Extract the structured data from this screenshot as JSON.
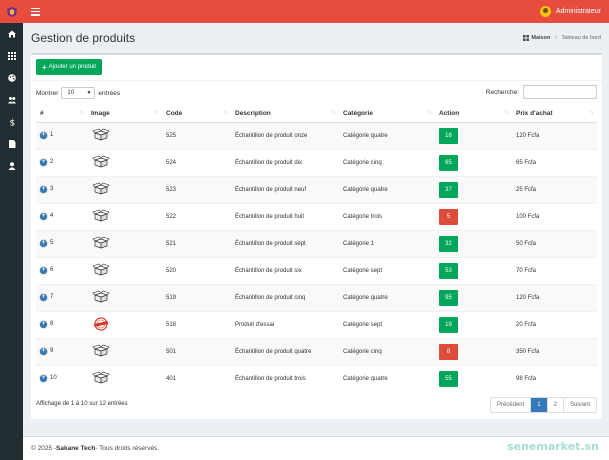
{
  "sidebar": {
    "logo_icon": "shield-logo-icon",
    "items": [
      {
        "icon": "home-icon"
      },
      {
        "icon": "grid-icon"
      },
      {
        "icon": "palette-icon"
      },
      {
        "icon": "users-icon"
      },
      {
        "icon": "dollar-icon"
      },
      {
        "icon": "file-icon"
      },
      {
        "icon": "user-icon"
      }
    ]
  },
  "header": {
    "menu_icon": "hamburger-icon",
    "user_name": "Administrateur"
  },
  "page": {
    "title": "Gestion de produits",
    "breadcrumb_home": "Maison",
    "breadcrumb_current": "Tableau de bord"
  },
  "toolbar": {
    "add_label": "Ajouter un produit"
  },
  "table_controls": {
    "show_label": "Montrer",
    "page_length": "10",
    "entries_label": "entrées",
    "search_label": "Recherche:",
    "search_value": ""
  },
  "table": {
    "columns": [
      "#",
      "Image",
      "Code",
      "Description",
      "Catégorie",
      "Action",
      "Prix d'achat"
    ],
    "rows": [
      {
        "num": "1",
        "image": "box",
        "code": "525",
        "description": "Échantillon de produit onze",
        "category": "Catégorie quatre",
        "action": "16",
        "status": "green",
        "price": "120 Fcfa"
      },
      {
        "num": "2",
        "image": "box",
        "code": "524",
        "description": "Échantillon de produit dix",
        "category": "Catégorie cinq",
        "action": "65",
        "status": "green",
        "price": "65 Fcfa"
      },
      {
        "num": "3",
        "image": "box",
        "code": "523",
        "description": "Échantillon de produit neuf",
        "category": "Catégorie quatre",
        "action": "37",
        "status": "green",
        "price": "25 Fcfa"
      },
      {
        "num": "4",
        "image": "box",
        "code": "522",
        "description": "Échantillon de produit huit",
        "category": "Catégorie trois",
        "action": "5",
        "status": "red",
        "price": "100 Fcfa"
      },
      {
        "num": "5",
        "image": "box",
        "code": "521",
        "description": "Échantillon de produit sept",
        "category": "Catégorie 1",
        "action": "32",
        "status": "green",
        "price": "50 Fcfa"
      },
      {
        "num": "6",
        "image": "box",
        "code": "520",
        "description": "Échantillon de produit six",
        "category": "Catégorie sept",
        "action": "53",
        "status": "green",
        "price": "70 Fcfa"
      },
      {
        "num": "7",
        "image": "box",
        "code": "519",
        "description": "Échantillon de produit cinq",
        "category": "Catégorie quatre",
        "action": "95",
        "status": "green",
        "price": "120 Fcfa"
      },
      {
        "num": "8",
        "image": "stamp",
        "code": "518",
        "description": "Produit d'essai",
        "category": "Catégorie sept",
        "action": "19",
        "status": "green",
        "price": "20 Fcfa"
      },
      {
        "num": "9",
        "image": "box",
        "code": "501",
        "description": "Échantillon de produit quatre",
        "category": "Catégorie cinq",
        "action": "8",
        "status": "red",
        "price": "350 Fcfa"
      },
      {
        "num": "10",
        "image": "box",
        "code": "401",
        "description": "Échantillon de produit trois",
        "category": "Catégorie quatre",
        "action": "55",
        "status": "green",
        "price": "98 Fcfa"
      }
    ]
  },
  "pagination": {
    "info": "Affichage de 1 à 10 sur 12 entrées",
    "prev": "Précédent",
    "pages": [
      "1",
      "2"
    ],
    "active_page": "1",
    "next": "Suivant"
  },
  "footer": {
    "copyright": "© 2025 - ",
    "brand": "Sakane Tech",
    "rights": " - Tous droits réservés."
  },
  "watermark": "senemarket.sn",
  "colors": {
    "primary_red": "#e74c3c",
    "sidebar_dark": "#222d32",
    "success_green": "#00a65a",
    "danger_red": "#dd4b39",
    "link_blue": "#337ab7"
  }
}
